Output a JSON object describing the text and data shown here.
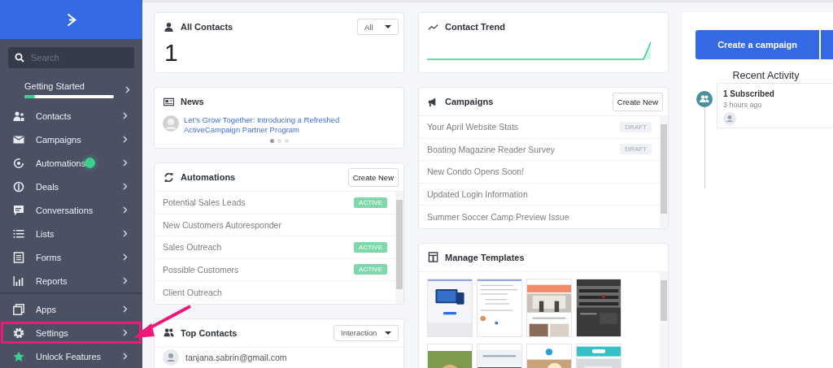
{
  "sidebar": {
    "search": {
      "placeholder": "Search"
    },
    "items": [
      {
        "label": "Getting Started",
        "level": 0.12,
        "dot": false
      },
      {
        "label": "Contacts",
        "dot": false
      },
      {
        "label": "Campaigns",
        "dot": false
      },
      {
        "label": "Automations",
        "dot": true
      },
      {
        "label": "Deals",
        "dot": false
      },
      {
        "label": "Conversations",
        "dot": false
      },
      {
        "label": "Lists",
        "dot": false
      },
      {
        "label": "Forms",
        "dot": false
      },
      {
        "label": "Reports",
        "dot": false
      }
    ],
    "footer_items": [
      {
        "label": "Apps",
        "highlighted": false
      },
      {
        "label": "Settings",
        "highlighted": true
      },
      {
        "label": "Unlock Features",
        "highlighted": false
      }
    ]
  },
  "all_contacts": {
    "title": "All Contacts",
    "count": "1",
    "filter": "All"
  },
  "news": {
    "title": "News",
    "headline": "Let’s Grow Together: Introducing a Refreshed ActiveCampaign Partner Program",
    "pages": [
      {
        "selected": true
      },
      {
        "selected": false
      },
      {
        "selected": false
      }
    ]
  },
  "automations": {
    "title": "Automations",
    "button": "Create New",
    "rows": [
      {
        "name": "Potential Sales Leads",
        "status": "ACTIVE",
        "color": "#7fd8ac"
      },
      {
        "name": "New Customers Autoresponder"
      },
      {
        "name": "Sales Outreach",
        "status": "ACTIVE",
        "color": "#7fd8ac"
      },
      {
        "name": "Possible Customers",
        "status": "ACTIVE",
        "color": "#7fd8ac"
      },
      {
        "name": "Client Outreach"
      }
    ]
  },
  "top_contacts": {
    "title": "Top Contacts",
    "filter": "Interaction",
    "rows": [
      {
        "email": "tanjana.sabrin@gmail.com"
      }
    ]
  },
  "contact_trend": {
    "title": "Contact Trend"
  },
  "campaigns": {
    "title": "Campaigns",
    "button": "Create New",
    "rows": [
      {
        "name": "Your April Website Stats",
        "status": "DRAFT",
        "color": "#eef1f5"
      },
      {
        "name": "Boating Magazine Reader Survey",
        "status": "DRAFT",
        "color": "#eef1f5"
      },
      {
        "name": "New Condo Opens Soon!"
      },
      {
        "name": "Updated Login Information"
      },
      {
        "name": "Summer Soccer Camp Preview Issue"
      }
    ]
  },
  "templates": {
    "title": "Manage Templates"
  },
  "activity_panel": {
    "button": "Create a campaign",
    "heading": "Recent Activity",
    "items": [
      {
        "title": "1 Subscribed",
        "time": "3 hours ago"
      }
    ]
  }
}
